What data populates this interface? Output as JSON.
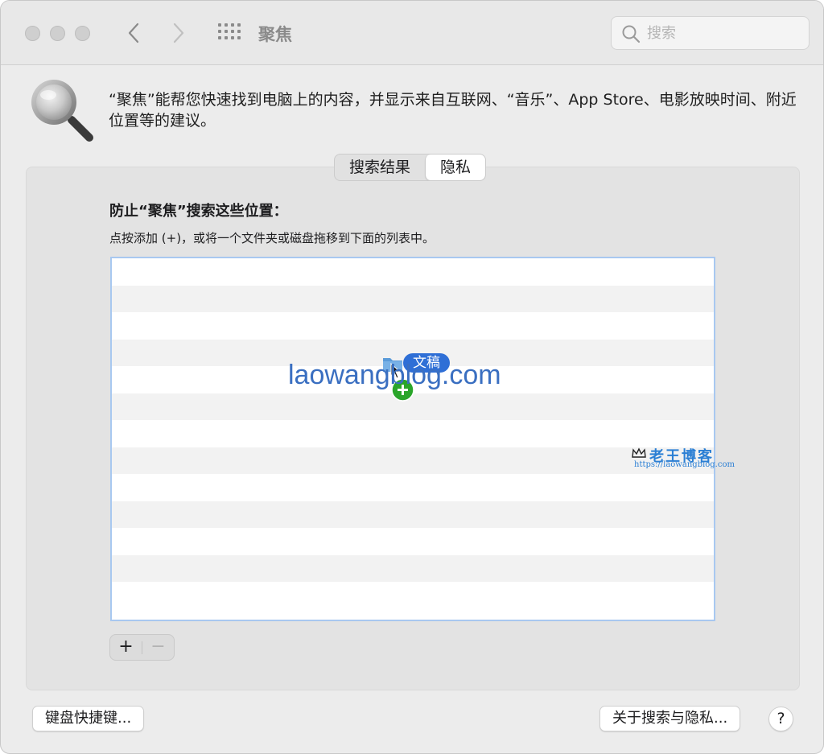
{
  "window": {
    "title": "聚焦",
    "title_icon": "grid-icon"
  },
  "toolbar": {
    "back_icon": "chevron-left-icon",
    "forward_icon": "chevron-right-icon",
    "search_placeholder": "搜索"
  },
  "header": {
    "description": "“聚焦”能帮您快速找到电脑上的内容，并显示来自互联网、“音乐”、App Store、电影放映时间、附近位置等的建议。",
    "icon": "spotlight-magnifier-icon"
  },
  "tabs": [
    {
      "label": "搜索结果",
      "selected": false
    },
    {
      "label": "隐私",
      "selected": true
    }
  ],
  "privacy": {
    "title": "防止“聚焦”搜索这些位置：",
    "hint": "点按添加 (+)，或将一个文件夹或磁盘拖移到下面的列表中。",
    "list_rows": 13,
    "add_label": "+",
    "remove_label": "−"
  },
  "drag": {
    "item_label": "文稿",
    "icon": "folder-icon",
    "badge_icon": "plus-badge-icon"
  },
  "watermark": {
    "url": "laowangblog.com",
    "logo": "老王博客",
    "logo_url": "https://laowangblog.com"
  },
  "footer": {
    "shortcuts_label": "键盘快捷键...",
    "about_label": "关于搜索与隐私...",
    "help_label": "?"
  },
  "colors": {
    "accent": "#2f6fd6",
    "list_border": "#a8c8f0",
    "watermark": "#3a6fc1"
  }
}
